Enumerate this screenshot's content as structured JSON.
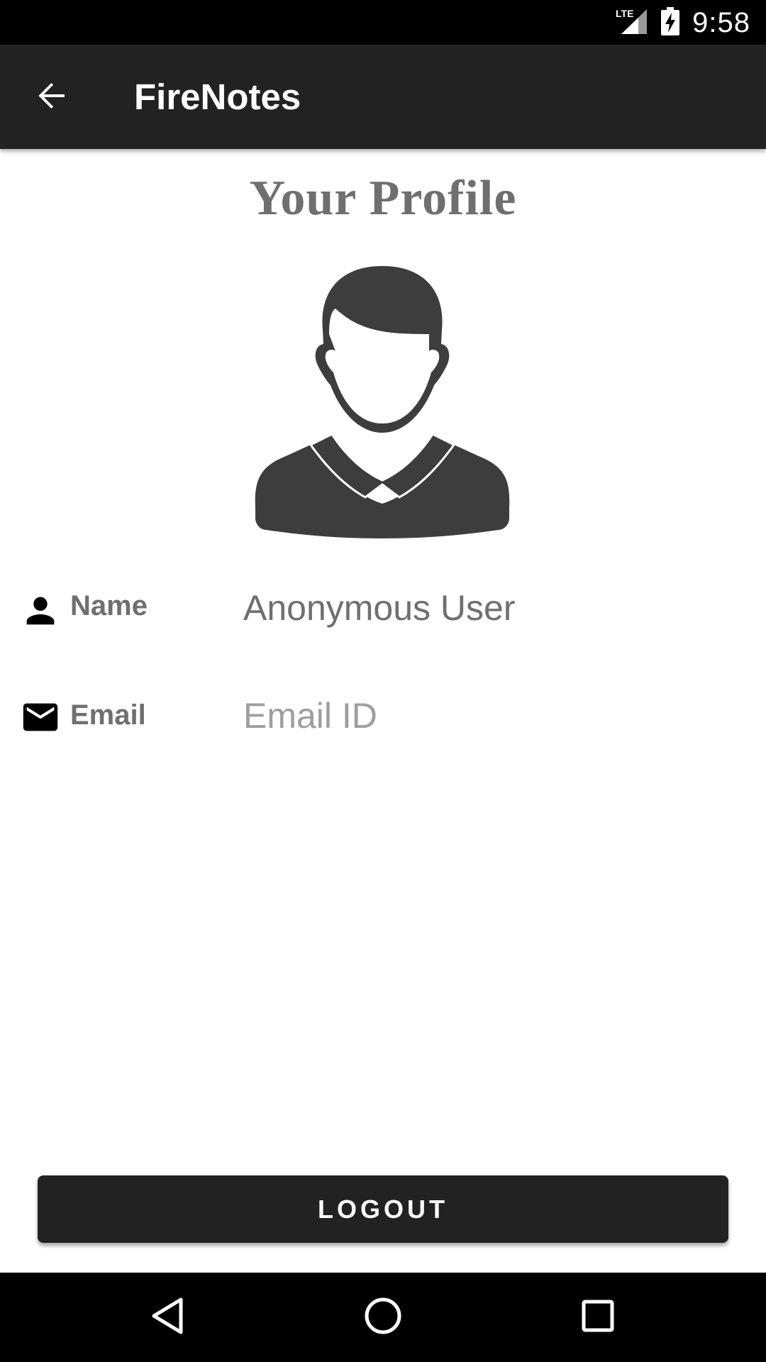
{
  "status_bar": {
    "network": "LTE",
    "time": "9:58",
    "icons": [
      "lte-signal-icon",
      "battery-charging-icon"
    ]
  },
  "app_bar": {
    "title": "FireNotes",
    "back_icon": "arrow-back-icon"
  },
  "profile": {
    "heading": "Your Profile",
    "avatar_icon": "user-avatar-icon",
    "fields": [
      {
        "icon": "person-icon",
        "label": "Name",
        "value": "Anonymous User"
      },
      {
        "icon": "email-icon",
        "label": "Email",
        "placeholder": "Email ID"
      }
    ]
  },
  "actions": {
    "logout_label": "LOGOUT"
  },
  "nav_bar": {
    "icons": [
      "back-triangle-icon",
      "home-circle-icon",
      "recents-square-icon"
    ]
  },
  "colors": {
    "app_bar": "#222222",
    "text_gray": "#6f6f6f",
    "placeholder_gray": "#9e9e9e",
    "avatar": "#3d3d3d"
  }
}
